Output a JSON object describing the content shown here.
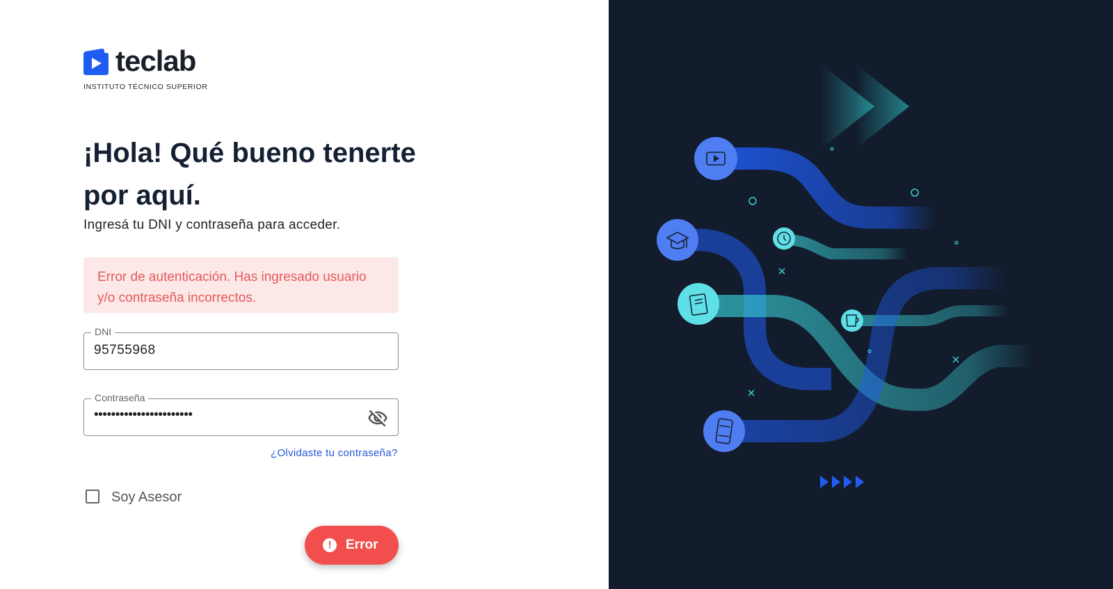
{
  "brand": {
    "name": "teclab",
    "tagline": "INSTITUTO TÉCNICO SUPERIOR"
  },
  "heading": {
    "title": "¡Hola! Qué bueno tenerte por aquí.",
    "subtitle": "Ingresá tu DNI y contraseña para acceder."
  },
  "alert": {
    "message": "Error de autenticación. Has ingresado usuario y/o contraseña incorrectos."
  },
  "dni_field": {
    "label": "DNI",
    "value": "95755968"
  },
  "password_field": {
    "label": "Contraseña",
    "value": "•••••••••••••••••••••••",
    "visibility_icon": "eye-off-icon"
  },
  "forgot_link": {
    "label": "¿Olvidaste tu contraseña?"
  },
  "advisor_checkbox": {
    "label": "Soy Asesor",
    "checked": false
  },
  "submit_button": {
    "label": "Error",
    "icon": "alert-circle-icon",
    "color": "#f24e4e"
  },
  "colors": {
    "brand_blue": "#1f5cf2",
    "panel_bg": "#121c2c",
    "alert_bg": "#fde8e8",
    "alert_text": "#e45a5a"
  }
}
